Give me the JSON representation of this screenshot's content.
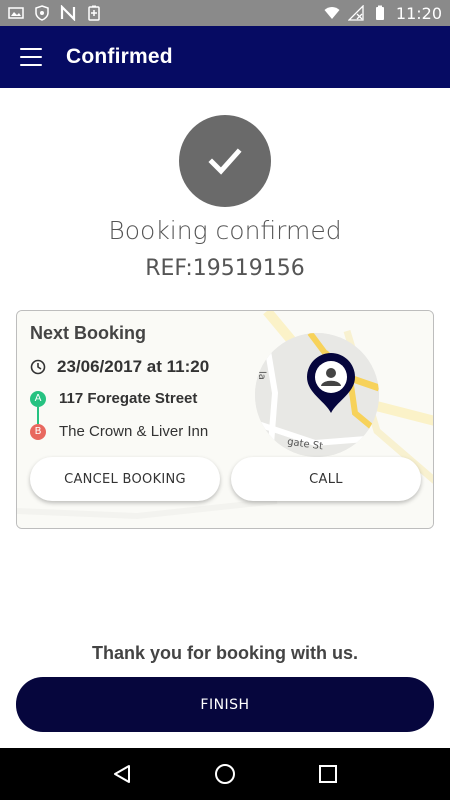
{
  "status_bar": {
    "time": "11:20",
    "left_icons": [
      "image-icon",
      "shield-icon",
      "n-icon",
      "battery-saver-icon"
    ],
    "right_icons": [
      "wifi-icon",
      "no-signal-icon",
      "battery-icon"
    ]
  },
  "app_bar": {
    "title": "Confirmed",
    "background": "#060b63"
  },
  "confirmation": {
    "icon": "check-icon",
    "title": "Booking confirmed",
    "ref": "REF:19519156"
  },
  "booking_card": {
    "title": "Next Booking",
    "datetime": "23/06/2017 at 11:20",
    "pickup_marker": "A",
    "pickup": "117 Foregate Street",
    "dropoff_marker": "B",
    "dropoff": "The Crown & Liver Inn",
    "map_street_label": "gate St",
    "cancel_label": "CANCEL BOOKING",
    "call_label": "CALL",
    "colors": {
      "pickup": "#26c281",
      "dropoff": "#e8685f"
    }
  },
  "footer": {
    "thanks": "Thank you for booking with us.",
    "finish_label": "FINISH",
    "finish_color": "#06063d"
  },
  "nav_bar": {
    "buttons": [
      "back-icon",
      "home-icon",
      "recents-icon"
    ]
  }
}
